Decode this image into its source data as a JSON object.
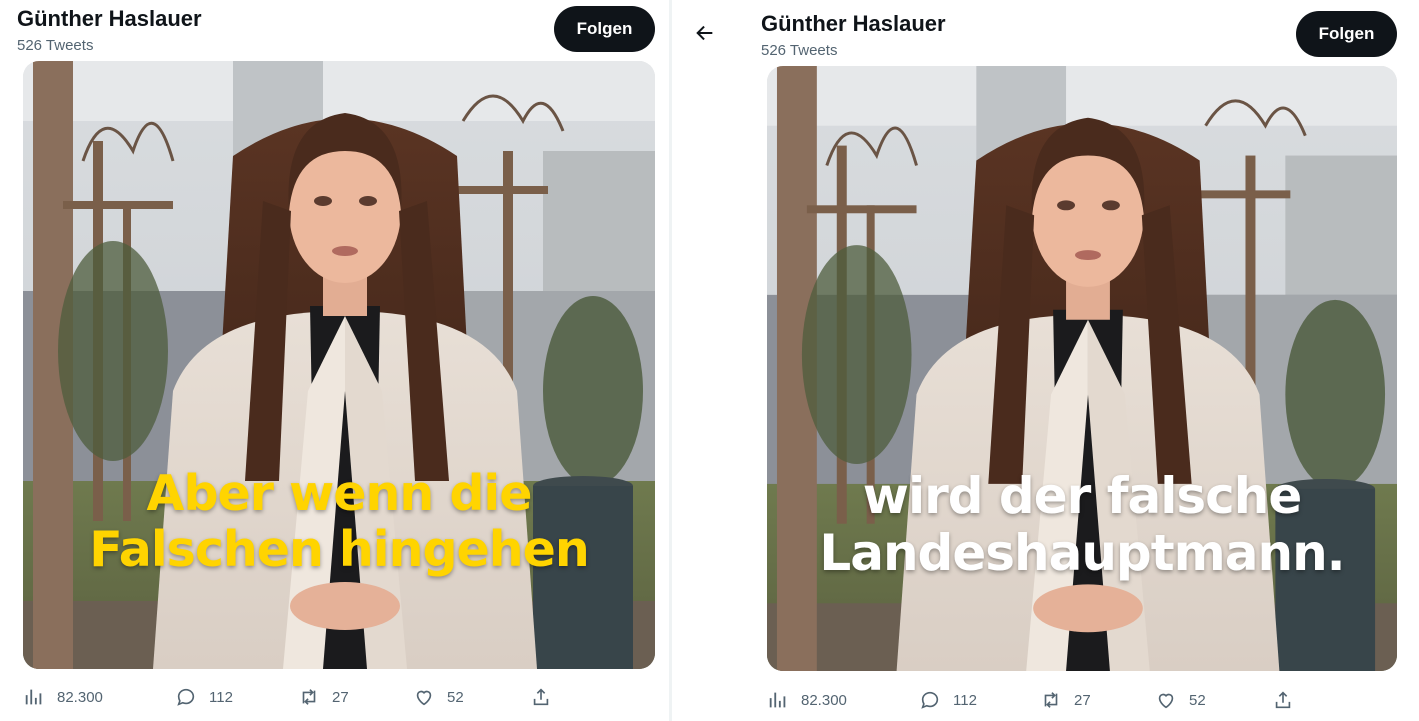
{
  "panels": [
    {
      "profile_name": "Günther Haslauer",
      "tweet_count": "526 Tweets",
      "follow_label": "Folgen",
      "caption_lines": [
        "Aber wenn die",
        "Falschen hingehen"
      ],
      "caption_color": "#ffd400",
      "stats": {
        "views": "82.300",
        "replies": "112",
        "retweets": "27",
        "likes": "52"
      }
    },
    {
      "profile_name": "Günther Haslauer",
      "tweet_count": "526 Tweets",
      "follow_label": "Folgen",
      "caption_lines": [
        "wird der falsche",
        "Landeshauptmann."
      ],
      "caption_color": "#ffffff",
      "stats": {
        "views": "82.300",
        "replies": "112",
        "retweets": "27",
        "likes": "52"
      }
    }
  ],
  "icons": {
    "back": "arrow-left-icon",
    "views": "bar-chart-icon",
    "reply": "speech-bubble-icon",
    "retweet": "retweet-arrows-icon",
    "like": "heart-icon",
    "share": "share-upload-icon"
  },
  "colors": {
    "text_primary": "#0f1419",
    "text_secondary": "#536471",
    "button_bg": "#0f1419"
  }
}
